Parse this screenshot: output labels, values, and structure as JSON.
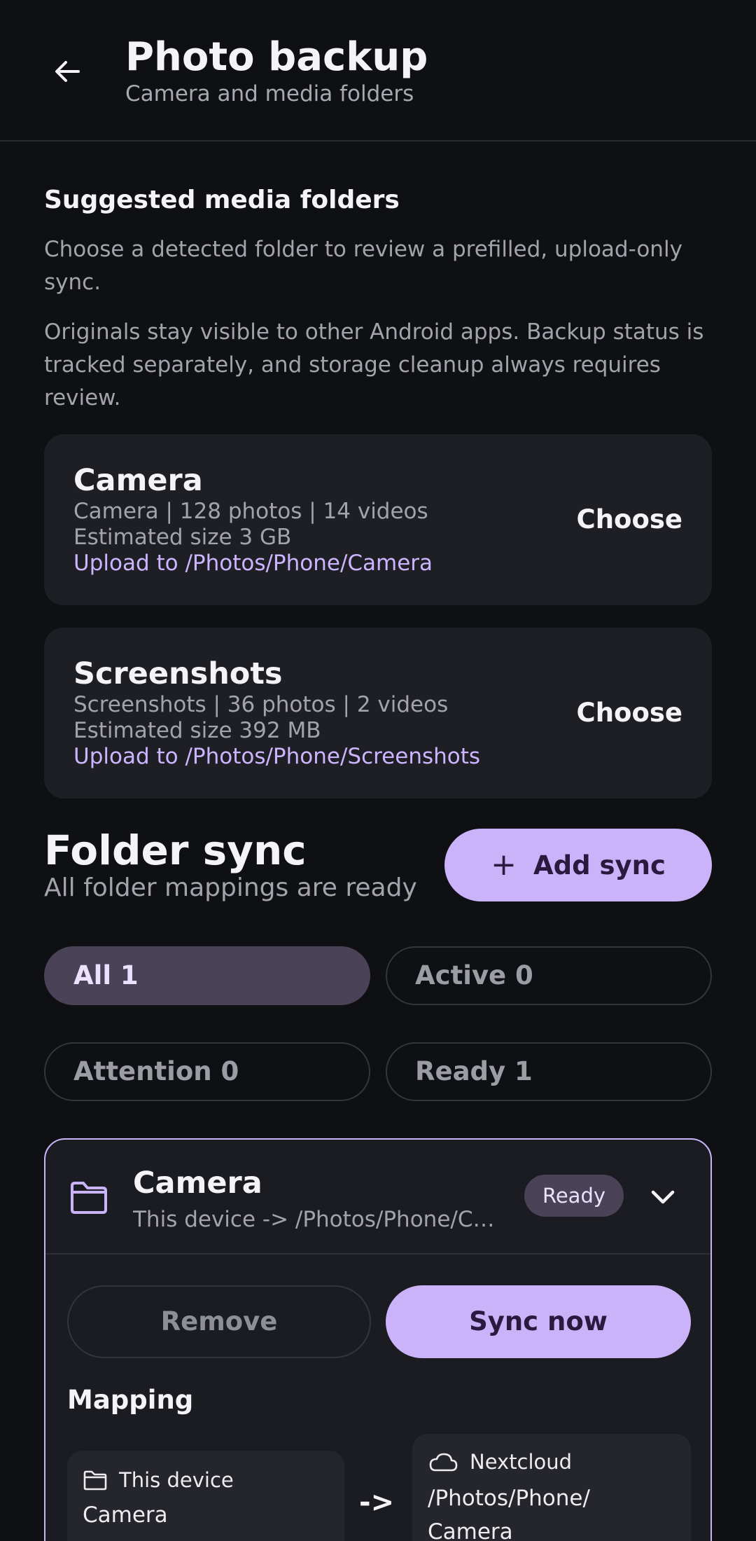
{
  "appbar": {
    "back_icon": "arrow-back-icon",
    "title": "Photo backup",
    "subtitle": "Camera and media folders"
  },
  "suggested": {
    "title": "Suggested media folders",
    "description_1": "Choose a detected folder to review a prefilled, upload-only sync.",
    "description_2": "Originals stay visible to other Android apps. Backup status is tracked separately, and storage cleanup always requires review.",
    "folders": [
      {
        "name": "Camera",
        "summary": "Camera | 128 photos | 14 videos",
        "size": "Estimated size 3 GB",
        "destination": "Upload to /Photos/Phone/Camera",
        "action": "Choose"
      },
      {
        "name": "Screenshots",
        "summary": "Screenshots | 36 photos | 2 videos",
        "size": "Estimated size 392 MB",
        "destination": "Upload to /Photos/Phone/Screenshots",
        "action": "Choose"
      }
    ]
  },
  "folder_sync": {
    "title": "Folder sync",
    "subtitle": "All folder mappings are ready",
    "add_button": {
      "icon": "plus-icon",
      "label": "Add sync"
    },
    "filters": [
      {
        "label": "All 1",
        "selected": true
      },
      {
        "label": "Active 0",
        "selected": false
      },
      {
        "label": "Attention 0",
        "selected": false
      },
      {
        "label": "Ready 1",
        "selected": false
      }
    ]
  },
  "sync_item": {
    "icon": "folder-icon",
    "name": "Camera",
    "path": "This device -> /Photos/Phone/Camera",
    "status": "Ready",
    "expand_icon": "chevron-down-icon",
    "remove_label": "Remove",
    "sync_now_label": "Sync now",
    "mapping_title": "Mapping",
    "source": {
      "icon": "folder-icon",
      "label": "This device",
      "value": "Camera"
    },
    "arrow": "->",
    "destination": {
      "icon": "cloud-icon",
      "label": "Nextcloud",
      "value": "/Photos/Phone/ Camera"
    }
  },
  "colors": {
    "background": "#0f1014",
    "surface": "#1e1f24",
    "accent": "#cbb3fa",
    "accent_text": "#2a1a40",
    "link": "#cdb4ff",
    "muted_text": "#a3a3ab"
  }
}
